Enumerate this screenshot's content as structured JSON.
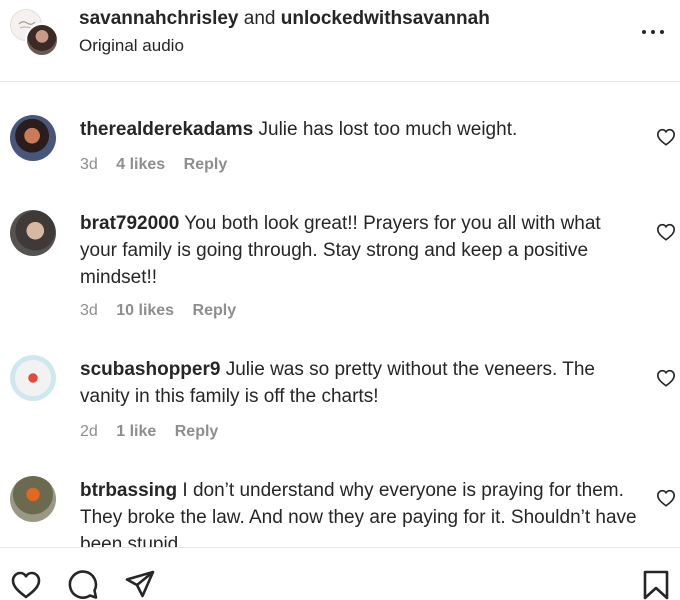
{
  "header": {
    "user1": "savannahchrisley",
    "joiner": "and",
    "user2": "unlockedwithsavannah",
    "subtitle": "Original audio",
    "more_icon": "more-horizontal-icon"
  },
  "comments": [
    {
      "username": "therealderekadams",
      "text": "Julie has lost too much weight.",
      "time": "3d",
      "likes": "4 likes",
      "reply": "Reply"
    },
    {
      "username": "brat792000",
      "text": "You both look great!! Prayers for you all with what your family is going through. Stay strong and keep a positive mindset!!",
      "time": "3d",
      "likes": "10 likes",
      "reply": "Reply"
    },
    {
      "username": "scubashopper9",
      "text": "Julie was so pretty without the veneers. The vanity in this family is off the charts!",
      "time": "2d",
      "likes": "1 like",
      "reply": "Reply"
    },
    {
      "username": "btrbassing",
      "text": "I don’t understand why everyone is praying for them. They broke the law. And now they are paying for it. Shouldn’t have been stupid",
      "time": "",
      "likes": "",
      "reply": ""
    }
  ],
  "bottom_bar": {
    "icons": [
      "heart-icon",
      "comment-icon",
      "share-icon",
      "bookmark-icon"
    ]
  }
}
